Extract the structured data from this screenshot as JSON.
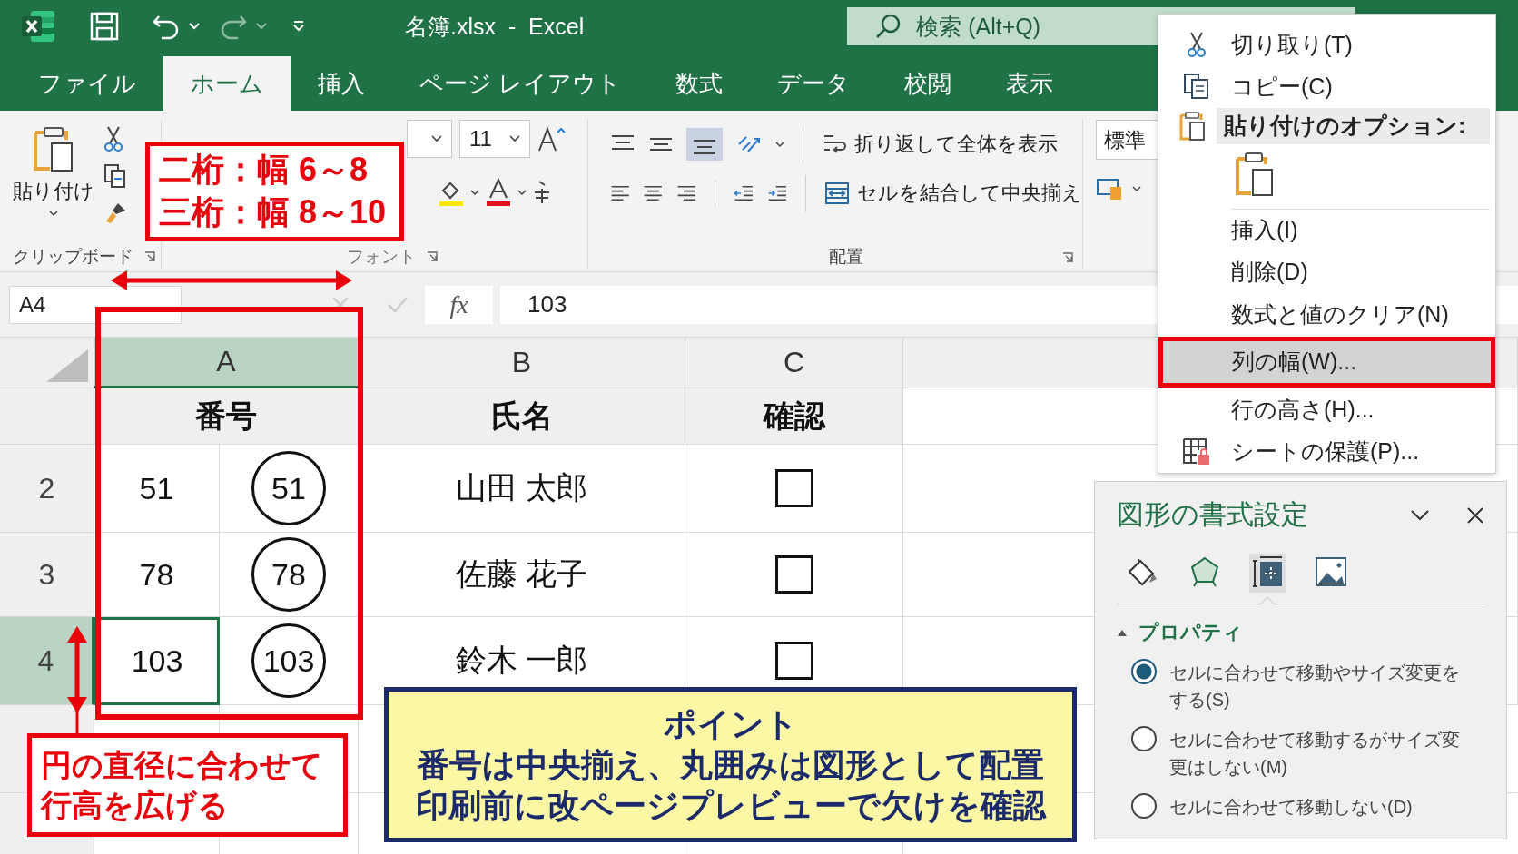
{
  "title_bar": {
    "title": "名簿.xlsx  -  Excel",
    "search_placeholder": "検索 (Alt+Q)"
  },
  "tabs": [
    {
      "label": "ファイル",
      "selected": false
    },
    {
      "label": "ホーム",
      "selected": true
    },
    {
      "label": "挿入",
      "selected": false
    },
    {
      "label": "ページ レイアウト",
      "selected": false
    },
    {
      "label": "数式",
      "selected": false
    },
    {
      "label": "データ",
      "selected": false
    },
    {
      "label": "校閲",
      "selected": false
    },
    {
      "label": "表示",
      "selected": false
    }
  ],
  "ribbon": {
    "paste_label": "貼り付け",
    "clipboard_group": "クリップボード",
    "font_size": "11",
    "font_group": "フォント",
    "wrap_text": "折り返して全体を表示",
    "merge_center": "セルを結合して中央揃え",
    "alignment_group": "配置",
    "number_format": "標準"
  },
  "formula_bar": {
    "name_box": "A4",
    "function_label": "fx",
    "value": "103"
  },
  "sheet": {
    "columns": [
      {
        "label": "A",
        "selected": true
      },
      {
        "label": "B",
        "selected": false
      },
      {
        "label": "C",
        "selected": false
      }
    ],
    "header_row": [
      "番号",
      "氏名",
      "確認"
    ],
    "rows": [
      {
        "number": "2",
        "value": "51",
        "circled": "51",
        "name": "山田 太郎",
        "checked": false,
        "selected": false
      },
      {
        "number": "3",
        "value": "78",
        "circled": "78",
        "name": "佐藤 花子",
        "checked": false,
        "selected": false
      },
      {
        "number": "4",
        "value": "103",
        "circled": "103",
        "name": "鈴木 一郎",
        "checked": false,
        "selected": true
      }
    ]
  },
  "context_menu": {
    "items": [
      {
        "kind": "cut",
        "label": "切り取り(T)",
        "selected": false
      },
      {
        "kind": "copy",
        "label": "コピー(C)",
        "selected": false
      },
      {
        "kind": "header",
        "label": "貼り付けのオプション:"
      },
      {
        "kind": "paste",
        "selected": false
      },
      {
        "kind": "item",
        "label": "挿入(I)",
        "selected": false
      },
      {
        "kind": "item",
        "label": "削除(D)",
        "selected": false
      },
      {
        "kind": "item",
        "label": "数式と値のクリア(N)",
        "selected": false
      },
      {
        "kind": "item",
        "label": "列の幅(W)...",
        "selected": true
      },
      {
        "kind": "item",
        "label": "行の高さ(H)...",
        "selected": false
      },
      {
        "kind": "protect",
        "label": "シートの保護(P)...",
        "selected": false
      }
    ]
  },
  "format_pane": {
    "title": "図形の書式設定",
    "tabs": [
      {
        "kind": "fill",
        "selected": false
      },
      {
        "kind": "effects",
        "selected": false
      },
      {
        "kind": "size",
        "selected": true
      },
      {
        "kind": "picture",
        "selected": false
      }
    ],
    "section": "プロパティ",
    "expanded": true,
    "options": [
      {
        "label": "セルに合わせて移動やサイズ変更をする(S)",
        "selected": true
      },
      {
        "label": "セルに合わせて移動するがサイズ変更はしない(M)",
        "selected": false
      },
      {
        "label": "セルに合わせて移動しない(D)",
        "selected": false
      }
    ]
  },
  "annotations": {
    "width_note": [
      "二桁：幅 6～8",
      "三桁：幅 8～10"
    ],
    "row_note": [
      "円の直径に合わせて",
      "行高を広げる"
    ],
    "point": {
      "title": "ポイント",
      "lines": [
        "番号は中央揃え、丸囲みは図形として配置",
        "印刷前に改ページプレビューで欠けを確認"
      ]
    }
  }
}
